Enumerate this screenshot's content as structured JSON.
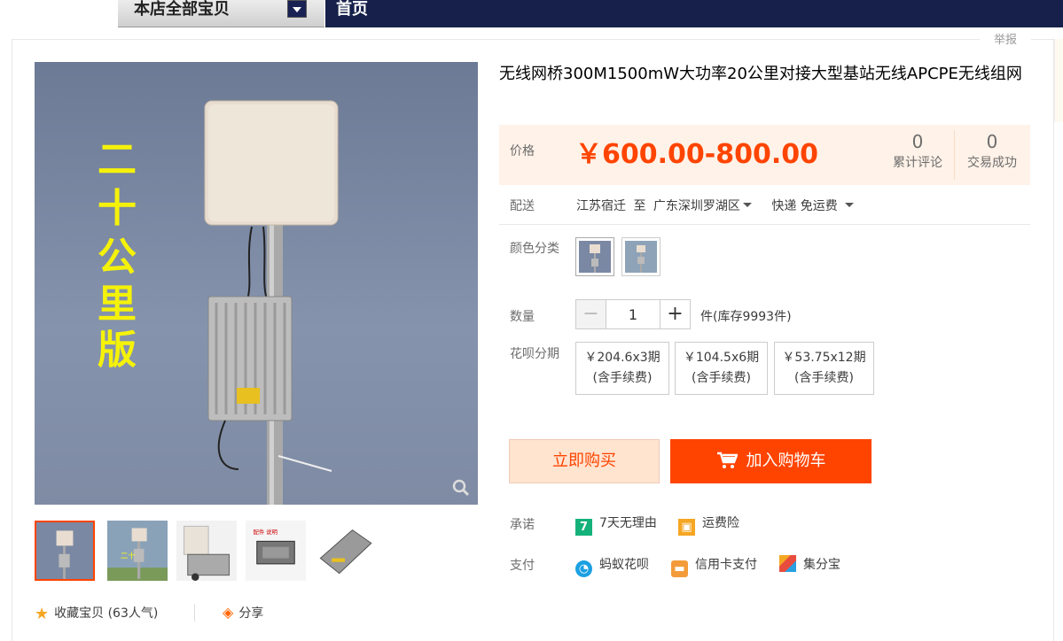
{
  "header": {
    "shop_all": "本店全部宝贝",
    "nav_home": "首页"
  },
  "report": "举报",
  "gallery": {
    "overlay_text": [
      "二",
      "十",
      "公",
      "里",
      "版"
    ],
    "thumbnails": 5
  },
  "footer": {
    "favorite": "收藏宝贝 (63人气)",
    "share": "分享"
  },
  "product": {
    "title": "无线网桥300M1500mW大功率20公里对接大型基站无线APCPE无线组网",
    "price_label": "价格",
    "price": "￥600.00-800.00",
    "reviews_count": "0",
    "reviews_label": "累计评论",
    "deals_count": "0",
    "deals_label": "交易成功",
    "delivery_label": "配送",
    "delivery_from": "江苏宿迁",
    "delivery_to_word": "至",
    "delivery_to": "广东深圳罗湖区",
    "delivery_method": "快递 免运费",
    "color_label": "颜色分类",
    "qty_label": "数量",
    "qty_minus": "−",
    "qty_value": "1",
    "qty_plus": "+",
    "stock": "件(库存9993件)",
    "installment_label": "花呗分期",
    "installments": [
      {
        "price": "￥204.6x3期",
        "fee": "(含手续费)"
      },
      {
        "price": "￥104.5x6期",
        "fee": "(含手续费)"
      },
      {
        "price": "￥53.75x12期",
        "fee": "(含手续费)"
      }
    ],
    "buy_now": "立即购买",
    "add_cart": "加入购物车",
    "promise_label": "承诺",
    "promise_items": [
      "7天无理由",
      "运费险"
    ],
    "pay_label": "支付",
    "pay_items": [
      "蚂蚁花呗",
      "信用卡支付",
      "集分宝"
    ]
  },
  "colors": {
    "accent": "#ff4400",
    "nav": "#16204a",
    "price_bg": "#fff2e8"
  }
}
